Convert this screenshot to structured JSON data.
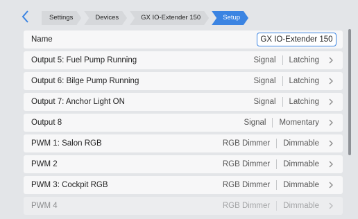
{
  "breadcrumb": [
    "Settings",
    "Devices",
    "GX IO-Extender 150",
    "Setup"
  ],
  "name_row": {
    "label": "Name",
    "value": "GX IO-Extender 150"
  },
  "rows": [
    {
      "label": "Output 5: Fuel Pump Running",
      "type": "Signal",
      "mode": "Latching"
    },
    {
      "label": "Output 6: Bilge Pump Running",
      "type": "Signal",
      "mode": "Latching"
    },
    {
      "label": "Output 7: Anchor Light ON",
      "type": "Signal",
      "mode": "Latching"
    },
    {
      "label": "Output 8",
      "type": "Signal",
      "mode": "Momentary"
    },
    {
      "label": "PWM 1: Salon RGB",
      "type": "RGB Dimmer",
      "mode": "Dimmable"
    },
    {
      "label": "PWM 2",
      "type": "RGB Dimmer",
      "mode": "Dimmable"
    },
    {
      "label": "PWM 3: Cockpit RGB",
      "type": "RGB Dimmer",
      "mode": "Dimmable"
    },
    {
      "label": "PWM 4",
      "type": "RGB Dimmer",
      "mode": "Dimmable"
    }
  ],
  "colors": {
    "accent": "#3b84e2",
    "background": "#e3e5e8",
    "row": "#f7f7f8"
  },
  "icons": {
    "back": "chevron-left-icon",
    "row_chevron": "chevron-right-icon"
  }
}
